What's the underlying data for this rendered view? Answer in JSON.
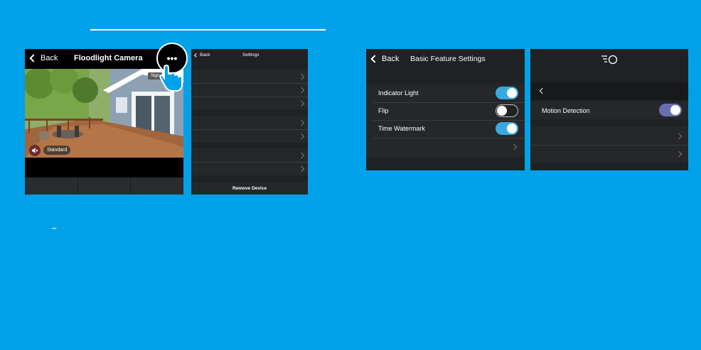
{
  "camera_screen": {
    "back_label": "Back",
    "title": "Floodlight Camera",
    "sign_badge": "Sign",
    "quality_label": "Standard"
  },
  "settings_screen": {
    "back_label": "Back",
    "title": "Settings",
    "remove_label": "Remove Device"
  },
  "basic_screen": {
    "back_label": "Back",
    "title": "Basic Feature Settings",
    "rows": [
      {
        "label": "Indicator Light",
        "on": true
      },
      {
        "label": "Flip",
        "on": false
      },
      {
        "label": "Time Watermark",
        "on": true
      }
    ]
  },
  "detection_screen": {
    "motion_label": "Motion Detection",
    "motion_on": true
  },
  "more_glyph": "•••",
  "small_dots": "•••",
  "colors": {
    "background": "#00a1e9",
    "toggle_on": "#3aa8e0",
    "toggle_on_alt": "#6a6eb0",
    "panel": "#1f2124"
  }
}
